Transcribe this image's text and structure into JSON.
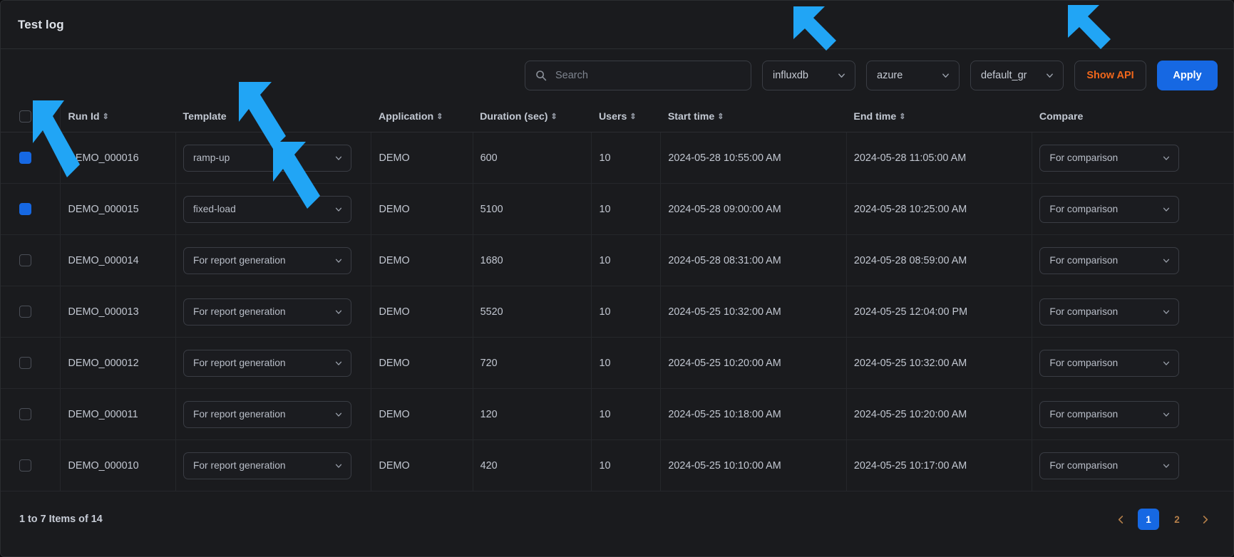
{
  "header": {
    "title": "Test log"
  },
  "toolbar": {
    "search": {
      "placeholder": "Search",
      "value": ""
    },
    "db_select": {
      "value": "influxdb"
    },
    "env_select": {
      "value": "azure"
    },
    "group_select": {
      "value": "default_gr"
    },
    "show_api_label": "Show API",
    "apply_label": "Apply",
    "accent_orange": "#f0671b",
    "accent_blue": "#1668e3"
  },
  "table": {
    "columns": [
      {
        "key": "check",
        "label": "",
        "sortable": false
      },
      {
        "key": "runid",
        "label": "Run Id",
        "sortable": true
      },
      {
        "key": "template",
        "label": "Template",
        "sortable": false
      },
      {
        "key": "app",
        "label": "Application",
        "sortable": true
      },
      {
        "key": "duration",
        "label": "Duration (sec)",
        "sortable": true
      },
      {
        "key": "users",
        "label": "Users",
        "sortable": true
      },
      {
        "key": "start",
        "label": "Start time",
        "sortable": true
      },
      {
        "key": "end",
        "label": "End time",
        "sortable": true
      },
      {
        "key": "compare",
        "label": "Compare",
        "sortable": false
      }
    ],
    "header_checkbox_checked": false,
    "rows": [
      {
        "checked": true,
        "runid": "DEMO_000016",
        "template": "ramp-up",
        "app": "DEMO",
        "duration": "600",
        "users": "10",
        "start": "2024-05-28 10:55:00 AM",
        "end": "2024-05-28 11:05:00 AM",
        "compare": "For comparison"
      },
      {
        "checked": true,
        "runid": "DEMO_000015",
        "template": "fixed-load",
        "app": "DEMO",
        "duration": "5100",
        "users": "10",
        "start": "2024-05-28 09:00:00 AM",
        "end": "2024-05-28 10:25:00 AM",
        "compare": "For comparison"
      },
      {
        "checked": false,
        "runid": "DEMO_000014",
        "template": "For report generation",
        "app": "DEMO",
        "duration": "1680",
        "users": "10",
        "start": "2024-05-28 08:31:00 AM",
        "end": "2024-05-28 08:59:00 AM",
        "compare": "For comparison"
      },
      {
        "checked": false,
        "runid": "DEMO_000013",
        "template": "For report generation",
        "app": "DEMO",
        "duration": "5520",
        "users": "10",
        "start": "2024-05-25 10:32:00 AM",
        "end": "2024-05-25 12:04:00 PM",
        "compare": "For comparison"
      },
      {
        "checked": false,
        "runid": "DEMO_000012",
        "template": "For report generation",
        "app": "DEMO",
        "duration": "720",
        "users": "10",
        "start": "2024-05-25 10:20:00 AM",
        "end": "2024-05-25 10:32:00 AM",
        "compare": "For comparison"
      },
      {
        "checked": false,
        "runid": "DEMO_000011",
        "template": "For report generation",
        "app": "DEMO",
        "duration": "120",
        "users": "10",
        "start": "2024-05-25 10:18:00 AM",
        "end": "2024-05-25 10:20:00 AM",
        "compare": "For comparison"
      },
      {
        "checked": false,
        "runid": "DEMO_000010",
        "template": "For report generation",
        "app": "DEMO",
        "duration": "420",
        "users": "10",
        "start": "2024-05-25 10:10:00 AM",
        "end": "2024-05-25 10:17:00 AM",
        "compare": "For comparison"
      }
    ]
  },
  "footer": {
    "count_text": "1 to 7 Items of 14",
    "pages": [
      {
        "label": "1",
        "active": true
      },
      {
        "label": "2",
        "active": false
      }
    ]
  },
  "annotations": {
    "arrow_color": "#21a5f5",
    "count": 6
  }
}
